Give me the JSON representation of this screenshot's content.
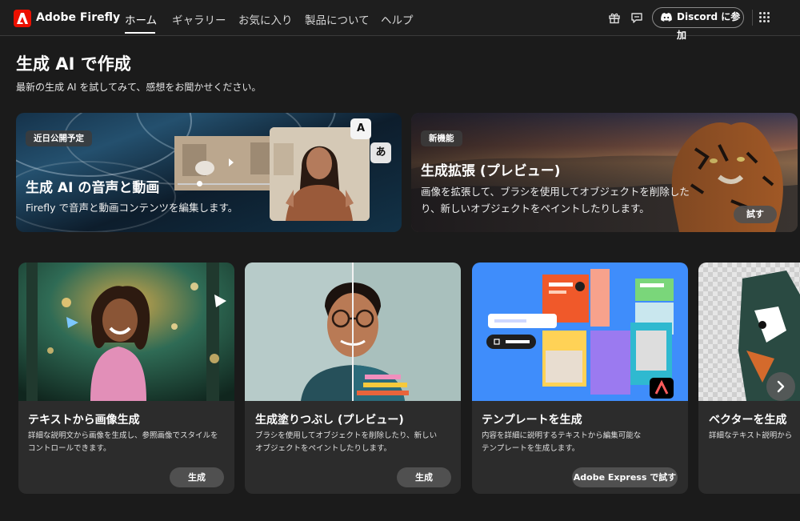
{
  "header": {
    "brand": "Adobe Firefly",
    "nav": [
      "ホーム",
      "ギャラリー",
      "お気に入り",
      "製品について",
      "ヘルプ"
    ],
    "discord_label": "Discord に参加"
  },
  "intro": {
    "title": "生成 AI で作成",
    "subtitle": "最新の生成 AI を試してみて、感想をお聞かせください。"
  },
  "banners": [
    {
      "badge": "近日公開予定",
      "title": "生成 AI の音声と動画",
      "desc": "Firefly で音声と動画コンテンツを編集します。",
      "glyphs": [
        "A",
        "あ"
      ]
    },
    {
      "badge": "新機能",
      "title": "生成拡張 (プレビュー)",
      "desc_line1": "画像を拡張して、ブラシを使用してオブジェクトを削除した",
      "desc_line2": "り、新しいオブジェクトをペイントしたりします。",
      "button": "試す"
    }
  ],
  "cards": [
    {
      "title": "テキストから画像生成",
      "desc_line1": "詳細な説明文から画像を生成し、参照画像でスタイルを",
      "desc_line2": "コントロールできます。",
      "button": "生成"
    },
    {
      "title": "生成塗りつぶし (プレビュー)",
      "desc_line1": "ブラシを使用してオブジェクトを削除したり、新しい",
      "desc_line2": "オブジェクトをペイントしたりします。",
      "button": "生成"
    },
    {
      "title": "テンプレートを生成",
      "desc_line1": "内容を詳細に説明するテキストから編集可能な",
      "desc_line2": "テンプレートを生成します。",
      "button": "Adobe Express で試す"
    },
    {
      "title": "ベクターを生成",
      "desc_line1": "詳細なテキスト説明から"
    }
  ]
}
